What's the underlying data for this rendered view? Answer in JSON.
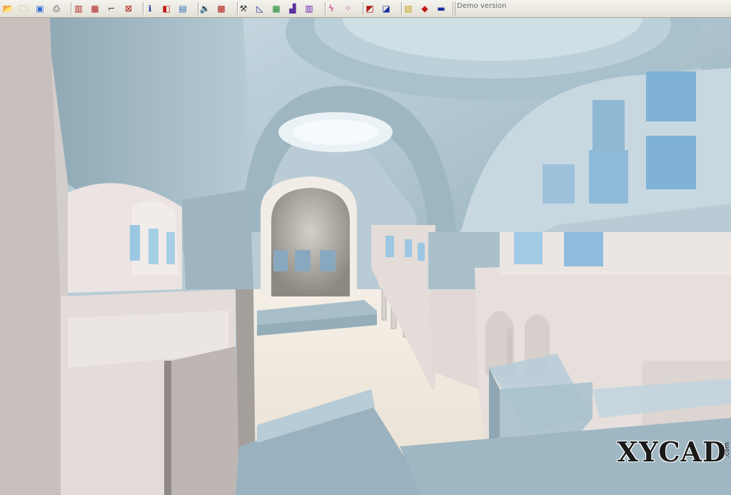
{
  "toolbar": {
    "demo_label": "Demo version",
    "buttons": [
      {
        "name": "open-folder-icon",
        "glyph": "📂",
        "color": "#c49a18"
      },
      {
        "name": "folder-icon",
        "glyph": "🗀",
        "color": "#c49a18"
      },
      {
        "name": "image-icon",
        "glyph": "▣",
        "color": "#2f6fd6"
      },
      {
        "name": "print-icon",
        "glyph": "⎙",
        "color": "#333333"
      },
      {
        "name": "frame-front-icon",
        "glyph": "▥",
        "color": "#b02020"
      },
      {
        "name": "frame-side-icon",
        "glyph": "▦",
        "color": "#b02020"
      },
      {
        "name": "stairs-icon",
        "glyph": "⌐",
        "color": "#333333"
      },
      {
        "name": "cross-frame-icon",
        "glyph": "⊠",
        "color": "#b02020"
      },
      {
        "name": "info-icon",
        "glyph": "ℹ",
        "color": "#1a2fa0"
      },
      {
        "name": "layers-icon",
        "glyph": "◧",
        "color": "#c01818"
      },
      {
        "name": "document-icon",
        "glyph": "▤",
        "color": "#2c6fb5"
      },
      {
        "name": "sound-icon",
        "glyph": "🔉",
        "color": "#444444"
      },
      {
        "name": "grid-red-icon",
        "glyph": "▩",
        "color": "#b01818"
      },
      {
        "name": "tools-icon",
        "glyph": "⚒",
        "color": "#333333"
      },
      {
        "name": "measure-icon",
        "glyph": "◺",
        "color": "#1a2fa0"
      },
      {
        "name": "color-grid-icon",
        "glyph": "▦",
        "color": "#1a8a2f"
      },
      {
        "name": "chart-icon",
        "glyph": "▟",
        "color": "#5a2fa0"
      },
      {
        "name": "palette-icon",
        "glyph": "▥",
        "color": "#6a1ab0"
      },
      {
        "name": "lightning-icon",
        "glyph": "ϟ",
        "color": "#c01877"
      },
      {
        "name": "dots-icon",
        "glyph": "⁘",
        "color": "#c01877"
      },
      {
        "name": "plane-view-icon",
        "glyph": "◩",
        "color": "#b01818"
      },
      {
        "name": "perspective-icon",
        "glyph": "◪",
        "color": "#1a2fa0"
      },
      {
        "name": "hatch-icon",
        "glyph": "▧",
        "color": "#c4a018"
      },
      {
        "name": "paint-icon",
        "glyph": "◆",
        "color": "#c01818"
      },
      {
        "name": "save-icon",
        "glyph": "▬",
        "color": "#1a2fa0"
      }
    ]
  },
  "viewport": {
    "logo": "XYCAD",
    "logo_suffix": ".com"
  }
}
